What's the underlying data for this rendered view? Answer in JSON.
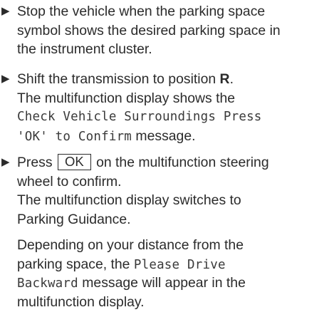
{
  "colors": {
    "text": "#2b2b2b",
    "background": "#ffffff"
  },
  "bullet_icon": "right-pointing-triangle",
  "steps": [
    {
      "line1": "Stop the vehicle when the parking space",
      "line2": "symbol shows the desired parking space in",
      "line3": "the instrument cluster."
    },
    {
      "line1_text": "Shift the transmission to position ",
      "line1_bold": "R",
      "line1_end": ".",
      "result_l1": "The multifunction display shows the",
      "result_code_a": "Check Vehicle Surroundings Press",
      "result_code_b": "'OK' to Confirm",
      "result_tail": " message."
    },
    {
      "pre": "Press ",
      "key": "OK",
      "post": " on the multifunction steering",
      "line2": "wheel to confirm.",
      "result_l1": "The multifunction display switches to",
      "result_l2": "Parking Guidance."
    }
  ],
  "note": {
    "line1": "Depending on your distance from the",
    "line2_text": "parking space, the ",
    "line2_code": "Please Drive",
    "line3_code": "Backward",
    "line3_text": " message will appear in the",
    "line4": "multifunction display."
  }
}
